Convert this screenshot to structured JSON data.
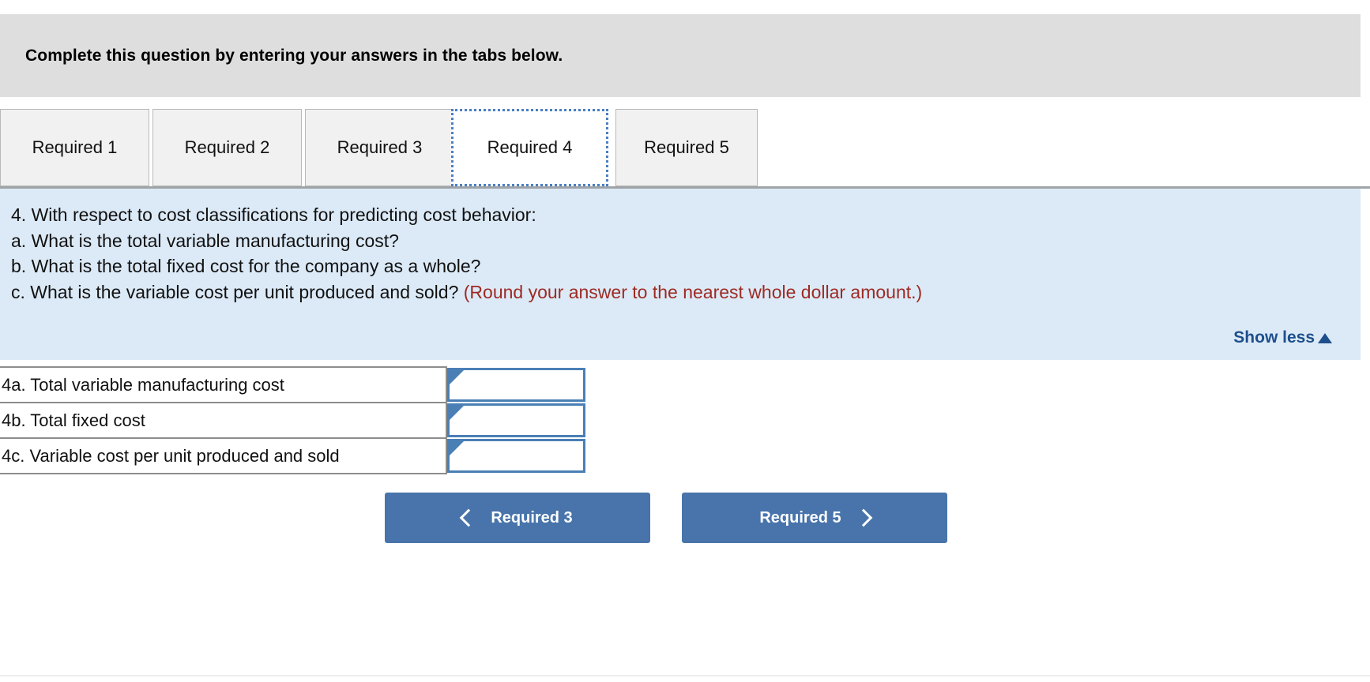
{
  "header": {
    "title": "Complete this question by entering your answers in the tabs below."
  },
  "tabs": {
    "items": [
      {
        "label": "Required 1",
        "active": false
      },
      {
        "label": "Required 2",
        "active": false
      },
      {
        "label": "Required 3",
        "active": false
      },
      {
        "label": "Required 4",
        "active": true
      },
      {
        "label": "Required 5",
        "active": false
      }
    ]
  },
  "instructions": {
    "line_main": "4. With respect to cost classifications for predicting cost behavior:",
    "line_a": "a. What is the total variable manufacturing cost?",
    "line_b": "b. What is the total fixed cost for the company as a whole?",
    "line_c_text": "c. What is the variable cost per unit produced and sold?",
    "line_c_note": "(Round your answer to the nearest whole dollar amount.)",
    "show_less_label": "Show less",
    "show_less_icon": "caret-up-icon"
  },
  "answer_table": {
    "rows": [
      {
        "label": "4a. Total variable manufacturing cost",
        "value": "",
        "placeholder": ""
      },
      {
        "label": "4b. Total fixed cost",
        "value": "",
        "placeholder": ""
      },
      {
        "label": "4c. Variable cost per unit produced and sold",
        "value": "",
        "placeholder": ""
      }
    ]
  },
  "navigation": {
    "prev_label": "Required 3",
    "prev_icon": "chevron-left-icon",
    "next_label": "Required 5",
    "next_icon": "chevron-right-icon"
  },
  "colors": {
    "header_bg": "#dedede",
    "panel_bg": "#dceaf7",
    "tab_inactive_bg": "#f1f1f1",
    "tab_active_border": "#4a7fc1",
    "note_red": "#9e2a23",
    "link_blue": "#1d4f8c",
    "button_blue": "#4874ab",
    "input_border": "#4a7fb5"
  }
}
